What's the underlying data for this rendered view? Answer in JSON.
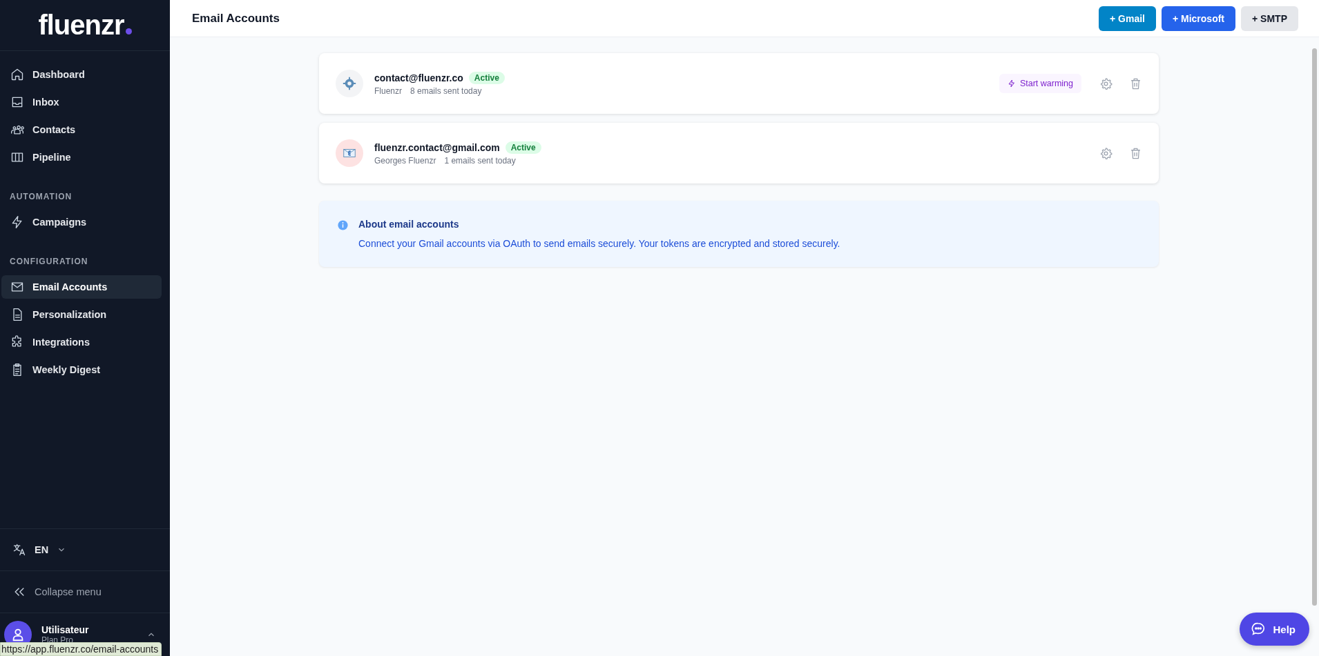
{
  "sidebar": {
    "logo": "fluenzr",
    "sections": [
      {
        "items": [
          {
            "label": "Dashboard",
            "selected": false
          },
          {
            "label": "Inbox",
            "selected": false
          },
          {
            "label": "Contacts",
            "selected": false
          },
          {
            "label": "Pipeline",
            "selected": false
          }
        ]
      },
      {
        "heading": "AUTOMATION",
        "items": [
          {
            "label": "Campaigns",
            "selected": false
          }
        ]
      },
      {
        "heading": "CONFIGURATION",
        "items": [
          {
            "label": "Email Accounts",
            "selected": true
          },
          {
            "label": "Personalization",
            "selected": false
          },
          {
            "label": "Integrations",
            "selected": false
          },
          {
            "label": "Weekly Digest",
            "selected": false
          }
        ]
      }
    ],
    "language": "EN",
    "collapse": "Collapse menu",
    "user": {
      "name": "Utilisateur",
      "plan": "Plan Pro"
    }
  },
  "header": {
    "title": "Email Accounts",
    "buttons": [
      {
        "label": "+ Gmail",
        "kind": "gmail"
      },
      {
        "label": "+ Microsoft",
        "kind": "microsoft"
      },
      {
        "label": "+ SMTP",
        "kind": "smtp"
      }
    ]
  },
  "accounts": [
    {
      "email": "contact@fluenzr.co",
      "status": "Active",
      "name": "Fluenzr",
      "sent": "8 emails sent today",
      "kind": "smtp",
      "warming": "Start warming"
    },
    {
      "email": "fluenzr.contact@gmail.com",
      "status": "Active",
      "name": "Georges Fluenzr",
      "sent": "1 emails sent today",
      "kind": "gmail"
    }
  ],
  "info": {
    "title": "About email accounts",
    "text": "Connect your Gmail accounts via OAuth to send emails securely. Your tokens are encrypted and stored securely."
  },
  "help": "Help",
  "status_bar": "https://app.fluenzr.co/email-accounts"
}
